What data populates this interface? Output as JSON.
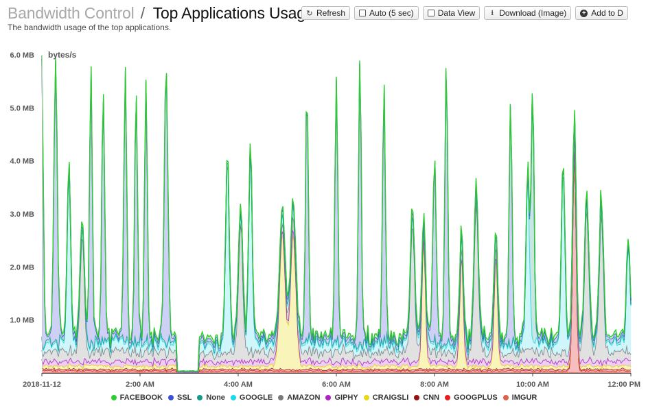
{
  "header": {
    "breadcrumb": "Bandwidth Control",
    "separator": "/",
    "title": "Top Applications Usage",
    "subtitle": "The bandwidth usage of the top applications."
  },
  "toolbar": {
    "refresh": {
      "label": "Refresh",
      "icon": "refresh-icon"
    },
    "auto": {
      "label": "Auto (5 sec)",
      "icon": "checkbox-icon"
    },
    "data_view": {
      "label": "Data View",
      "icon": "checkbox-icon"
    },
    "download": {
      "label": "Download (Image)",
      "icon": "download-icon"
    },
    "add_to": {
      "label": "Add to D",
      "icon": "plus-circle-icon"
    }
  },
  "chart_data": {
    "type": "area",
    "stacked": true,
    "ylabel": "bytes/s",
    "ylim": [
      0,
      6.0
    ],
    "yunit": "MB",
    "y_ticks": [
      {
        "value": 0,
        "label": ""
      },
      {
        "value": 1.0,
        "label": "1.0 MB"
      },
      {
        "value": 2.0,
        "label": "2.0 MB"
      },
      {
        "value": 3.0,
        "label": "3.0 MB"
      },
      {
        "value": 4.0,
        "label": "4.0 MB"
      },
      {
        "value": 5.0,
        "label": "5.0 MB"
      },
      {
        "value": 6.0,
        "label": "6.0 MB"
      }
    ],
    "xlim_hours": [
      0,
      12
    ],
    "x_ticks": [
      {
        "value": 0,
        "label": "2018-11-12"
      },
      {
        "value": 2,
        "label": "2:00 AM"
      },
      {
        "value": 4,
        "label": "4:00 AM"
      },
      {
        "value": 6,
        "label": "6:00 AM"
      },
      {
        "value": 8,
        "label": "8:00 AM"
      },
      {
        "value": 10,
        "label": "10:00 AM"
      },
      {
        "value": 12,
        "label": "12:00 PM"
      }
    ],
    "grid": false,
    "legend_position": "bottom",
    "series_order_bottom_to_top": [
      "IMGUR",
      "GOOGPLUS",
      "CNN",
      "CRAIGSLI",
      "GIPHY",
      "AMAZON",
      "GOOGLE",
      "None",
      "SSL",
      "FACEBOOK"
    ],
    "series": [
      {
        "name": "FACEBOOK",
        "color": "#2ecc2e",
        "fill": "#bdf0b8"
      },
      {
        "name": "SSL",
        "color": "#3b4fd6",
        "fill": "#c5c9f3"
      },
      {
        "name": "None",
        "color": "#149a8a",
        "fill": "#bfe2dc"
      },
      {
        "name": "GOOGLE",
        "color": "#1ad9ee",
        "fill": "#c6f5fa"
      },
      {
        "name": "AMAZON",
        "color": "#7a7a7a",
        "fill": "#dcdcdc"
      },
      {
        "name": "GIPHY",
        "color": "#b021c8",
        "fill": "#ebc6f1"
      },
      {
        "name": "CRAIGSLI",
        "color": "#e6d81a",
        "fill": "#f8f2ae"
      },
      {
        "name": "CNN",
        "color": "#9a1010",
        "fill": "#e3b5b5"
      },
      {
        "name": "GOOGPLUS",
        "color": "#e62020",
        "fill": "#f4b3b3"
      },
      {
        "name": "IMGUR",
        "color": "#e0604a",
        "fill": "#f3c6bd"
      }
    ],
    "peaks": [
      {
        "t": 0.0,
        "s": "SSL",
        "v": 5.2,
        "w": 0.04
      },
      {
        "t": 0.28,
        "s": "SSL",
        "v": 5.2,
        "w": 0.05
      },
      {
        "t": 0.55,
        "s": "GOOGLE",
        "v": 3.3,
        "w": 0.05
      },
      {
        "t": 0.82,
        "s": "AMAZON",
        "v": 2.3,
        "w": 0.06
      },
      {
        "t": 1.0,
        "s": "SSL",
        "v": 5.1,
        "w": 0.04
      },
      {
        "t": 1.25,
        "s": "SSL",
        "v": 4.7,
        "w": 0.04
      },
      {
        "t": 1.7,
        "s": "SSL",
        "v": 5.1,
        "w": 0.04
      },
      {
        "t": 1.92,
        "s": "SSL",
        "v": 4.7,
        "w": 0.04
      },
      {
        "t": 2.12,
        "s": "SSL",
        "v": 4.8,
        "w": 0.04
      },
      {
        "t": 2.53,
        "s": "SSL",
        "v": 5.2,
        "w": 0.05
      },
      {
        "t": 3.78,
        "s": "GOOGLE",
        "v": 3.6,
        "w": 0.05
      },
      {
        "t": 4.05,
        "s": "AMAZON",
        "v": 2.5,
        "w": 0.06
      },
      {
        "t": 4.25,
        "s": "GOOGLE",
        "v": 3.6,
        "w": 0.05
      },
      {
        "t": 4.9,
        "s": "CRAIGSLI",
        "v": 2.5,
        "w": 0.08
      },
      {
        "t": 5.12,
        "s": "CRAIGSLI",
        "v": 2.5,
        "w": 0.08
      },
      {
        "t": 5.4,
        "s": "SSL",
        "v": 4.7,
        "w": 0.04
      },
      {
        "t": 6.0,
        "s": "SSL",
        "v": 4.9,
        "w": 0.04
      },
      {
        "t": 6.48,
        "s": "SSL",
        "v": 5.3,
        "w": 0.04
      },
      {
        "t": 6.97,
        "s": "SSL",
        "v": 4.7,
        "w": 0.04
      },
      {
        "t": 7.55,
        "s": "AMAZON",
        "v": 2.5,
        "w": 0.06
      },
      {
        "t": 7.78,
        "s": "CRAIGSLI",
        "v": 2.4,
        "w": 0.05
      },
      {
        "t": 8.0,
        "s": "SSL",
        "v": 3.3,
        "w": 0.05
      },
      {
        "t": 8.24,
        "s": "SSL",
        "v": 5.3,
        "w": 0.04
      },
      {
        "t": 8.55,
        "s": "CRAIGSLI",
        "v": 2.1,
        "w": 0.05
      },
      {
        "t": 8.85,
        "s": "AMAZON",
        "v": 2.8,
        "w": 0.06
      },
      {
        "t": 9.25,
        "s": "CRAIGSLI",
        "v": 2.1,
        "w": 0.05
      },
      {
        "t": 9.55,
        "s": "SSL",
        "v": 4.6,
        "w": 0.04
      },
      {
        "t": 9.9,
        "s": "GOOGLE",
        "v": 3.2,
        "w": 0.05
      },
      {
        "t": 10.0,
        "s": "None",
        "v": 4.7,
        "w": 0.04
      },
      {
        "t": 10.62,
        "s": "GOOGLE",
        "v": 3.3,
        "w": 0.05
      },
      {
        "t": 10.85,
        "s": "GOOGPLUS",
        "v": 4.2,
        "w": 0.05
      },
      {
        "t": 11.1,
        "s": "AMAZON",
        "v": 2.7,
        "w": 0.06
      },
      {
        "t": 11.4,
        "s": "AMAZON",
        "v": 2.7,
        "w": 0.06
      },
      {
        "t": 11.95,
        "s": "GOOGLE",
        "v": 1.9,
        "w": 0.05
      }
    ]
  }
}
